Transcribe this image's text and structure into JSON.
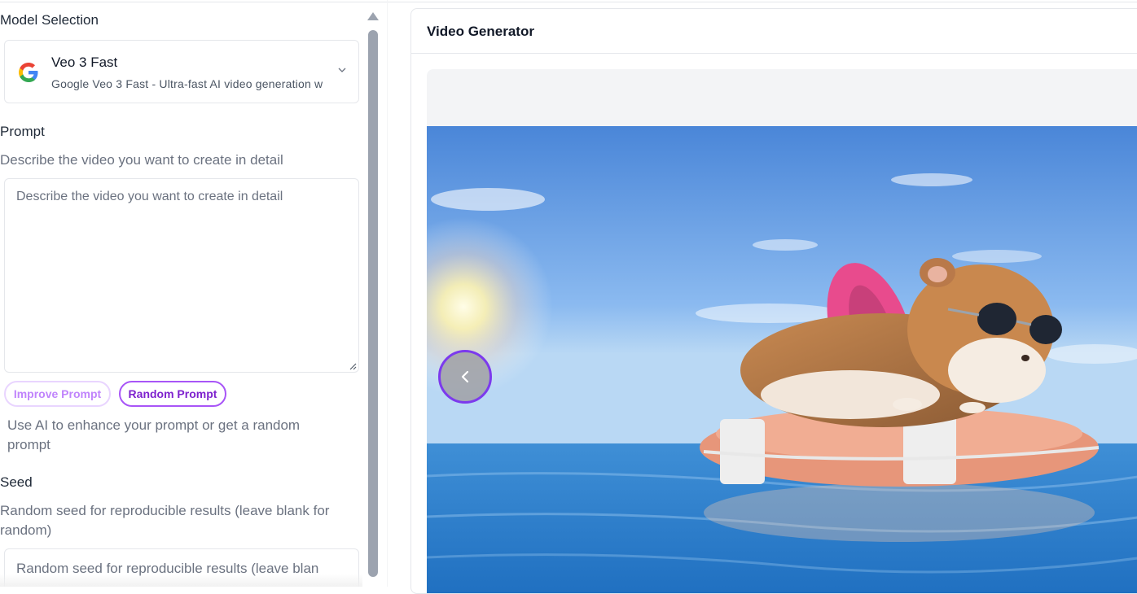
{
  "model_selection": {
    "label": "Model Selection",
    "selected_name": "Veo 3 Fast",
    "selected_description": "Google Veo 3 Fast - Ultra-fast AI video generation w",
    "logo_icon": "google-g-logo"
  },
  "prompt": {
    "label": "Prompt",
    "help": "Describe the video you want to create in detail",
    "placeholder": "Describe the video you want to create in detail",
    "value": "",
    "improve_button": "Improve Prompt",
    "random_button": "Random Prompt",
    "buttons_help": "Use AI to enhance your prompt or get a random prompt"
  },
  "seed": {
    "label": "Seed",
    "help": "Random seed for reproducible results (leave blank for random)",
    "placeholder": "Random seed for reproducible results (leave blan"
  },
  "generator": {
    "title": "Video Generator",
    "image_subject": "hamster-in-sunglasses-on-float-at-sea",
    "nav_icon": "chevron-left-icon"
  },
  "colors": {
    "accent": "#a855f7",
    "accent_dark": "#7e22ce",
    "accent_light": "#e9d5ff",
    "border": "#e5e7eb"
  }
}
